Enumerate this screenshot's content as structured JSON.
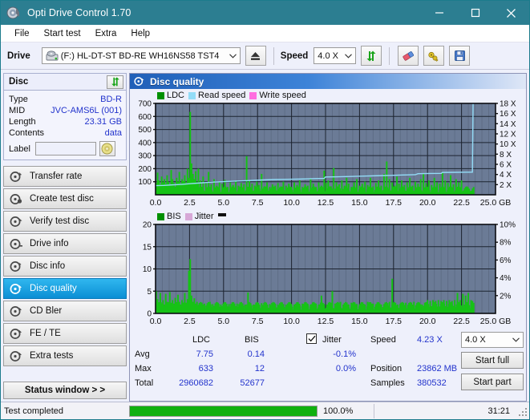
{
  "window": {
    "title": "Opti Drive Control 1.70",
    "icon": "disc-icon",
    "controls": {
      "minimize": "minimize-icon",
      "maximize": "maximize-icon",
      "close": "close-icon"
    }
  },
  "menu": {
    "items": [
      "File",
      "Start test",
      "Extra",
      "Help"
    ]
  },
  "toolbar": {
    "drive_label": "Drive",
    "drive_value": "(F:)  HL-DT-ST BD-RE  WH16NS58 TST4",
    "eject_icon": "eject-icon",
    "speed_label": "Speed",
    "speed_value": "4.0 X",
    "refresh_icon": "refresh-icon",
    "erase_icon": "eraser-icon",
    "key_icon": "key-icon",
    "save_icon": "save-icon"
  },
  "disc": {
    "header": "Disc",
    "refresh_icon": "refresh-icon",
    "rows": [
      {
        "key": "Type",
        "value": "BD-R"
      },
      {
        "key": "MID",
        "value": "JVC-AMS6L (001)"
      },
      {
        "key": "Length",
        "value": "23.31 GB"
      },
      {
        "key": "Contents",
        "value": "data"
      }
    ],
    "label_key": "Label",
    "label_value": "",
    "label_placeholder": "",
    "label_button_icon": "disc-icon"
  },
  "nav": {
    "items": [
      {
        "label": "Transfer rate",
        "icon": "disc-test-icon",
        "active": false
      },
      {
        "label": "Create test disc",
        "icon": "disc-burn-icon",
        "active": false
      },
      {
        "label": "Verify test disc",
        "icon": "disc-verify-icon",
        "active": false
      },
      {
        "label": "Drive info",
        "icon": "drive-info-icon",
        "active": false
      },
      {
        "label": "Disc info",
        "icon": "disc-info-icon",
        "active": false
      },
      {
        "label": "Disc quality",
        "icon": "disc-quality-icon",
        "active": true
      },
      {
        "label": "CD Bler",
        "icon": "disc-bler-icon",
        "active": false
      },
      {
        "label": "FE / TE",
        "icon": "disc-fete-icon",
        "active": false
      },
      {
        "label": "Extra tests",
        "icon": "disc-extra-icon",
        "active": false
      }
    ],
    "status_window": "Status window > >"
  },
  "panel": {
    "title": "Disc quality",
    "icon": "disc-quality-icon"
  },
  "stats": {
    "col_ldc": "LDC",
    "col_bis": "BIS",
    "jitter_label": "Jitter",
    "jitter_checked": true,
    "rows": [
      {
        "name": "Avg",
        "ldc": "7.75",
        "bis": "0.14",
        "jitter": "-0.1%"
      },
      {
        "name": "Max",
        "ldc": "633",
        "bis": "12",
        "jitter": "0.0%"
      },
      {
        "name": "Total",
        "ldc": "2960682",
        "bis": "52677",
        "jitter": ""
      }
    ],
    "speed_label": "Speed",
    "speed_value": "4.23 X",
    "position_label": "Position",
    "position_value": "23862 MB",
    "samples_label": "Samples",
    "samples_value": "380532",
    "speed_select": "4.0 X",
    "start_full": "Start full",
    "start_part": "Start part"
  },
  "statusbar": {
    "text": "Test completed",
    "percent": "100.0%",
    "progress": 100,
    "time": "31:21"
  },
  "colors": {
    "ldc_green": "#16c216",
    "read_speed_blue": "#93dcf7",
    "write_speed_pink": "#ff6ee0",
    "bis_green": "#16c216",
    "jitter_pink": "#d7a8d7",
    "plot_bg": "#6b7b96",
    "accent": "#2c7e91",
    "value_blue": "#2233cc"
  },
  "chart_data": [
    {
      "id": "disc-quality-ldc-chart",
      "type": "line",
      "title": "",
      "xlabel": "GB",
      "ylabel": "LDC",
      "xlim": [
        0,
        25
      ],
      "xticks": [
        0.0,
        2.5,
        5.0,
        7.5,
        10.0,
        12.5,
        15.0,
        17.5,
        20.0,
        22.5,
        25.0
      ],
      "xticklabels": [
        "0.0",
        "2.5",
        "5.0",
        "7.5",
        "10.0",
        "12.5",
        "15.0",
        "17.5",
        "20.0",
        "22.5",
        "25.0 GB"
      ],
      "ylim": [
        0,
        700
      ],
      "yticks": [
        100,
        200,
        300,
        400,
        500,
        600,
        700
      ],
      "y2label": "Speed",
      "y2lim": [
        0,
        18
      ],
      "y2ticks": [
        2,
        4,
        6,
        8,
        10,
        12,
        14,
        16,
        18
      ],
      "y2ticklabels": [
        "2 X",
        "4 X",
        "6 X",
        "8 X",
        "10 X",
        "12 X",
        "14 X",
        "16 X",
        "18 X"
      ],
      "grid": true,
      "legend": [
        "LDC",
        "Read speed",
        "Write speed"
      ],
      "legend_position": "top-left",
      "series": [
        {
          "name": "LDC",
          "kind": "impulse",
          "color": "#16c216",
          "x": [
            0.05,
            0.15,
            0.25,
            0.35,
            0.45,
            0.55,
            0.65,
            0.75,
            0.85,
            0.95,
            1.05,
            1.15,
            1.25,
            1.35,
            1.45,
            1.55,
            1.65,
            1.75,
            1.85,
            1.95,
            2.05,
            2.15,
            2.25,
            2.35,
            2.45,
            2.55,
            2.65,
            2.75,
            2.85,
            2.95,
            3.05,
            3.15,
            3.3,
            3.5,
            3.7,
            3.9,
            4.1,
            4.3,
            4.5,
            4.7,
            4.9,
            5.1,
            5.3,
            5.5,
            5.7,
            5.9,
            6.1,
            6.3,
            6.5,
            6.7,
            6.9,
            7.1,
            7.3,
            7.45,
            7.6,
            7.8,
            8.0,
            8.2,
            8.4,
            8.6,
            8.8,
            9.0,
            9.2,
            9.4,
            9.6,
            9.8,
            10.0,
            10.2,
            10.4,
            10.6,
            10.8,
            11.0,
            11.2,
            11.4,
            11.6,
            11.8,
            12.0,
            12.2,
            12.4,
            12.55,
            12.7,
            12.9,
            13.1,
            13.3,
            13.5,
            13.7,
            13.9,
            14.05,
            14.2,
            14.4,
            14.6,
            14.8,
            15.0,
            15.2,
            15.4,
            15.6,
            15.8,
            16.0,
            16.2,
            16.4,
            16.6,
            16.8,
            17.0,
            17.2,
            17.4,
            17.6,
            17.75,
            17.9,
            18.1,
            18.3,
            18.5,
            18.7,
            18.9,
            19.1,
            19.3,
            19.5,
            19.7,
            19.9,
            20.1,
            20.3,
            20.5,
            20.7,
            20.9,
            21.1,
            21.3,
            21.5,
            21.7,
            21.9,
            22.1,
            22.3,
            22.5,
            22.7,
            22.9,
            23.1,
            23.3
          ],
          "y": [
            90,
            170,
            110,
            80,
            140,
            95,
            120,
            85,
            150,
            100,
            70,
            190,
            120,
            90,
            60,
            130,
            100,
            175,
            85,
            120,
            105,
            150,
            90,
            200,
            130,
            635,
            240,
            160,
            120,
            180,
            95,
            200,
            110,
            140,
            90,
            175,
            80,
            120,
            70,
            100,
            85,
            115,
            60,
            95,
            75,
            105,
            70,
            90,
            80,
            295,
            110,
            85,
            70,
            100,
            75,
            160,
            65,
            95,
            60,
            80,
            70,
            90,
            55,
            100,
            70,
            85,
            60,
            95,
            75,
            110,
            60,
            80,
            70,
            120,
            85,
            60,
            95,
            70,
            185,
            90,
            110,
            65,
            205,
            95,
            80,
            110,
            70,
            130,
            85,
            60,
            95,
            120,
            70,
            85,
            100,
            75,
            130,
            65,
            90,
            110,
            70,
            160,
            255,
            120,
            95,
            70,
            140,
            85,
            110,
            75,
            95,
            130,
            70,
            100,
            85,
            120,
            165,
            90,
            110,
            75,
            130,
            95,
            85,
            175,
            110,
            90,
            150,
            80,
            120,
            95,
            110
          ]
        },
        {
          "name": "Read speed",
          "kind": "line",
          "color": "#93dcf7",
          "x": [
            0.0,
            0.6,
            1.2,
            1.9,
            2.6,
            3.4,
            4.2,
            5.0,
            5.9,
            6.8,
            7.7,
            8.7,
            9.7,
            10.7,
            11.7,
            12.4,
            12.5,
            13.4,
            14.3,
            15.3,
            16.3,
            17.3,
            18.2,
            19.1,
            19.3,
            20.2,
            21.0,
            21.1,
            22.0,
            22.9,
            23.3,
            23.35,
            23.35
          ],
          "y": [
            1.8,
            1.85,
            1.95,
            2.05,
            2.2,
            2.35,
            2.5,
            2.6,
            2.7,
            2.8,
            2.9,
            3.0,
            3.05,
            3.1,
            3.18,
            3.22,
            3.5,
            3.55,
            3.6,
            3.68,
            3.75,
            3.82,
            3.9,
            3.95,
            4.15,
            4.2,
            4.22,
            4.4,
            4.42,
            4.45,
            4.45,
            18.0,
            18.0
          ],
          "axis": "right"
        },
        {
          "name": "Write speed",
          "kind": "line",
          "color": "#ff6ee0",
          "x": [],
          "y": [],
          "axis": "right"
        }
      ]
    },
    {
      "id": "disc-quality-bis-chart",
      "type": "line",
      "title": "",
      "xlabel": "GB",
      "ylabel": "BIS",
      "xlim": [
        0,
        25
      ],
      "xticks": [
        0.0,
        2.5,
        5.0,
        7.5,
        10.0,
        12.5,
        15.0,
        17.5,
        20.0,
        22.5,
        25.0
      ],
      "xticklabels": [
        "0.0",
        "2.5",
        "5.0",
        "7.5",
        "10.0",
        "12.5",
        "15.0",
        "17.5",
        "20.0",
        "22.5",
        "25.0 GB"
      ],
      "ylim": [
        0,
        20
      ],
      "yticks": [
        0,
        5,
        10,
        15,
        20
      ],
      "y2label": "Jitter",
      "y2lim": [
        0,
        10
      ],
      "y2ticks": [
        2,
        4,
        6,
        8,
        10
      ],
      "y2ticklabels": [
        "2%",
        "4%",
        "6%",
        "8%",
        "10%"
      ],
      "grid": true,
      "legend": [
        "BIS",
        "Jitter"
      ],
      "legend_position": "top-left",
      "series": [
        {
          "name": "BIS",
          "kind": "impulse",
          "color": "#16c216",
          "x": [
            0.05,
            0.15,
            0.25,
            0.35,
            0.45,
            0.55,
            0.65,
            0.75,
            0.85,
            0.95,
            1.05,
            1.15,
            1.25,
            1.35,
            1.45,
            1.55,
            1.65,
            1.75,
            1.85,
            1.95,
            2.05,
            2.15,
            2.25,
            2.35,
            2.45,
            2.55,
            2.65,
            2.75,
            2.85,
            2.95,
            3.05,
            3.2,
            3.4,
            3.6,
            3.8,
            4.0,
            4.2,
            4.4,
            4.6,
            4.8,
            5.0,
            5.2,
            5.4,
            5.6,
            5.8,
            6.0,
            6.2,
            6.4,
            6.6,
            6.8,
            7.0,
            7.2,
            7.4,
            7.6,
            7.8,
            8.0,
            8.2,
            8.4,
            8.6,
            8.8,
            9.0,
            9.2,
            9.4,
            9.6,
            9.8,
            10.0,
            10.2,
            10.4,
            10.6,
            10.8,
            11.0,
            11.2,
            11.4,
            11.6,
            11.8,
            12.0,
            12.2,
            12.4,
            12.6,
            12.8,
            13.0,
            13.2,
            13.4,
            13.6,
            13.8,
            14.0,
            14.2,
            14.4,
            14.6,
            14.8,
            15.0,
            15.2,
            15.4,
            15.6,
            15.8,
            16.0,
            16.2,
            16.4,
            16.6,
            16.8,
            17.0,
            17.2,
            17.4,
            17.6,
            17.8,
            18.0,
            18.2,
            18.4,
            18.6,
            18.8,
            19.0,
            19.2,
            19.4,
            19.6,
            19.8,
            20.0,
            20.2,
            20.4,
            20.6,
            20.8,
            21.0,
            21.2,
            21.4,
            21.6,
            21.8,
            22.0,
            22.2,
            22.4,
            22.6,
            22.8,
            23.0,
            23.2,
            23.3
          ],
          "y": [
            5.0,
            3.2,
            2.5,
            4.6,
            2.2,
            3.0,
            2.0,
            4.4,
            2.6,
            2.0,
            4.8,
            2.4,
            3.0,
            2.2,
            3.5,
            2.0,
            4.2,
            2.6,
            2.0,
            3.0,
            2.2,
            4.6,
            2.4,
            3.2,
            9.6,
            12.2,
            4.0,
            2.6,
            3.4,
            2.2,
            2.6,
            2.0,
            2.4,
            2.2,
            2.0,
            2.6,
            2.1,
            2.0,
            2.3,
            2.0,
            2.2,
            2.0,
            2.1,
            2.0,
            2.0,
            2.2,
            2.0,
            2.1,
            2.0,
            4.7,
            2.2,
            2.0,
            2.1,
            2.0,
            2.3,
            2.0,
            2.0,
            2.1,
            2.0,
            2.2,
            2.0,
            2.0,
            2.1,
            2.0,
            2.2,
            2.0,
            2.0,
            2.1,
            2.0,
            2.2,
            2.0,
            2.1,
            2.0,
            2.0,
            2.2,
            2.0,
            4.0,
            2.1,
            2.0,
            2.4,
            5.0,
            2.2,
            2.0,
            2.6,
            2.0,
            2.2,
            2.0,
            2.4,
            2.0,
            2.1,
            2.0,
            2.2,
            2.0,
            2.6,
            2.0,
            2.2,
            2.0,
            2.4,
            2.0,
            2.1,
            2.0,
            2.6,
            7.8,
            2.4,
            2.0,
            2.2,
            2.0,
            2.4,
            2.0,
            2.1,
            2.6,
            2.0,
            2.2,
            2.0,
            2.4,
            3.0,
            2.8,
            3.0,
            2.8,
            3.0,
            2.8,
            3.0,
            2.8,
            3.0,
            2.8,
            3.0,
            4.6,
            3.0,
            4.4,
            4.0,
            4.6,
            3.0,
            2.8
          ]
        },
        {
          "name": "Jitter",
          "kind": "line",
          "color": "#d7a8d7",
          "x": [],
          "y": [],
          "axis": "right"
        }
      ]
    }
  ]
}
